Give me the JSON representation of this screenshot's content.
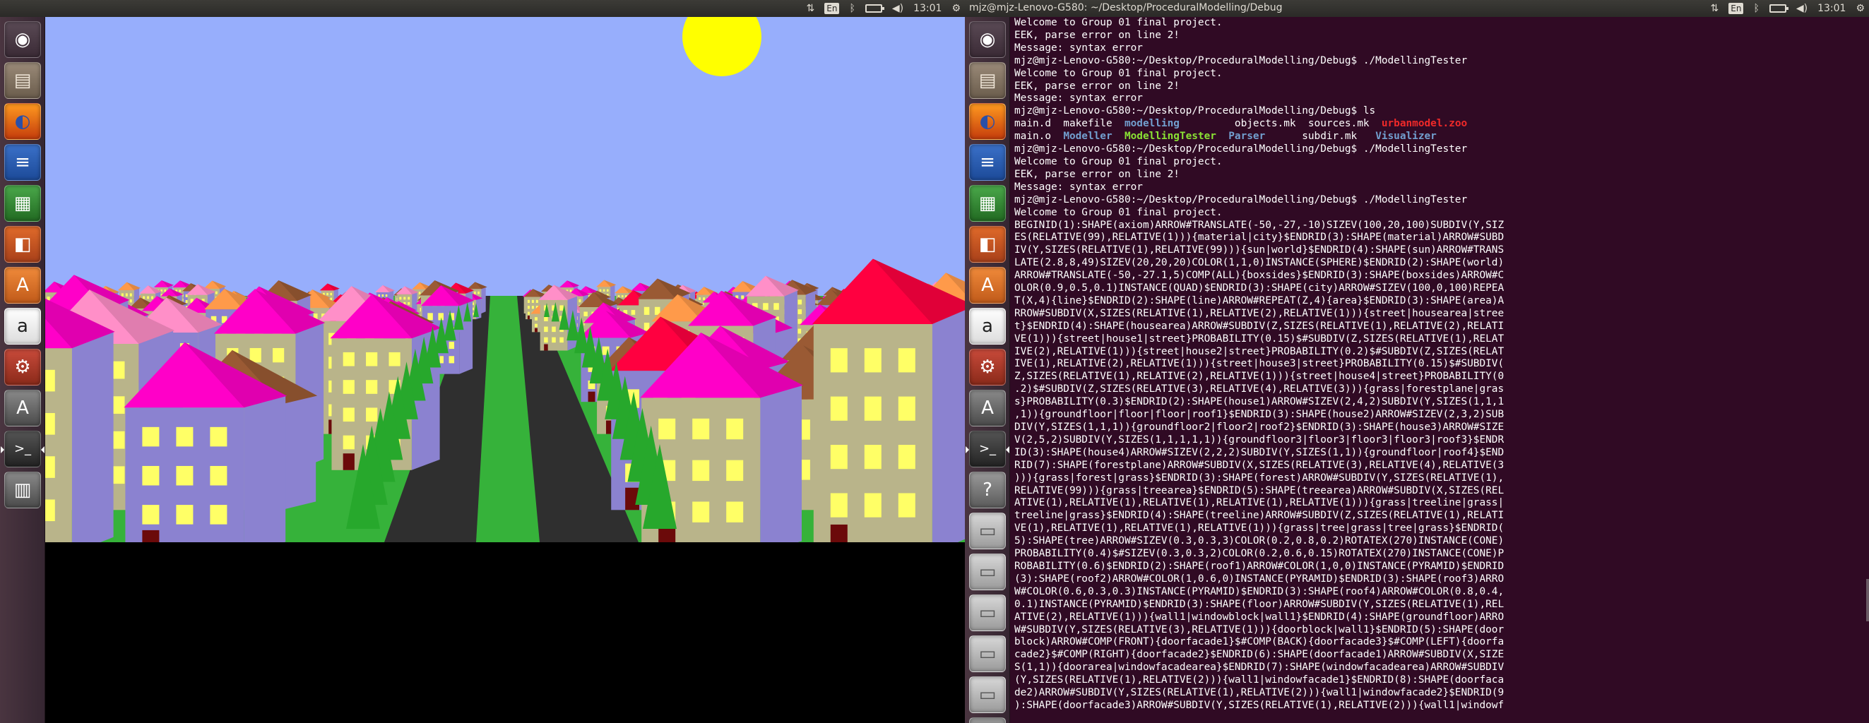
{
  "left_screen": {
    "clock": "13:01",
    "keyboard_layout": "En"
  },
  "right_screen": {
    "window_title": "mjz@mjz-Lenovo-G580: ~/Desktop/ProceduralModelling/Debug",
    "clock": "13:01",
    "keyboard_layout": "En"
  },
  "launcher": {
    "left_items": [
      "dash",
      "files",
      "firefox",
      "writer",
      "calc",
      "impress",
      "software-center",
      "amazon",
      "system-settings",
      "software-updater",
      "terminal",
      "workspaces"
    ],
    "right_items": [
      "dash",
      "files",
      "firefox",
      "writer",
      "calc",
      "impress",
      "software-center",
      "amazon",
      "system-settings",
      "software-updater",
      "terminal",
      "help",
      "drive-1",
      "drive-2",
      "drive-3",
      "drive-4",
      "drive-5",
      "trash"
    ]
  },
  "colors": {
    "sky": "#97aefc",
    "sun": "#ffff00",
    "ground": "#36b23a",
    "road": "#2f2f2f",
    "terminal_bg": "#300a24",
    "launcher": "#3f2d38",
    "roof_magenta": "#ff00c8",
    "roof_brown": "#9a5a34",
    "roof_pink": "#ff8fc8",
    "roof_orange": "#ff9a4a",
    "roof_red": "#ff0040",
    "wall_tan": "#b9b48a",
    "wall_purple": "#8b82d0",
    "window": "#ffff66",
    "door": "#6b0a0a"
  },
  "terminal": {
    "lines": [
      {
        "text": "Welcome to Group 01 final project."
      },
      {
        "text": "EEK, parse error on line 2!"
      },
      {
        "text": "Message: syntax error"
      },
      {
        "text": "mjz@mjz-Lenovo-G580:~/Desktop/ProceduralModelling/Debug$ ./ModellingTester"
      },
      {
        "text": "Welcome to Group 01 final project."
      },
      {
        "text": "EEK, parse error on line 2!"
      },
      {
        "text": "Message: syntax error"
      },
      {
        "text": "mjz@mjz-Lenovo-G580:~/Desktop/ProceduralModelling/Debug$ ls"
      },
      {
        "segments": [
          {
            "t": "main.d  makefile  ",
            "c": ""
          },
          {
            "t": "modelling",
            "c": "c-blue"
          },
          {
            "t": "         objects.mk  sources.mk  ",
            "c": ""
          },
          {
            "t": "urbanmodel.zoo",
            "c": "c-red"
          }
        ]
      },
      {
        "segments": [
          {
            "t": "main.o  ",
            "c": ""
          },
          {
            "t": "Modeller",
            "c": "c-blue"
          },
          {
            "t": "  ",
            "c": ""
          },
          {
            "t": "ModellingTester",
            "c": "c-green"
          },
          {
            "t": "  ",
            "c": ""
          },
          {
            "t": "Parser",
            "c": "c-blue"
          },
          {
            "t": "      subdir.mk   ",
            "c": ""
          },
          {
            "t": "Visualizer",
            "c": "c-blue"
          }
        ]
      },
      {
        "text": "mjz@mjz-Lenovo-G580:~/Desktop/ProceduralModelling/Debug$ ./ModellingTester"
      },
      {
        "text": "Welcome to Group 01 final project."
      },
      {
        "text": "EEK, parse error on line 2!"
      },
      {
        "text": "Message: syntax error"
      },
      {
        "text": "mjz@mjz-Lenovo-G580:~/Desktop/ProceduralModelling/Debug$ ./ModellingTester"
      },
      {
        "text": "Welcome to Group 01 final project."
      },
      {
        "text": "BEGINID(1):SHAPE(axiom)ARROW#TRANSLATE(-50,-27,-10)SIZEV(100,20,100)SUBDIV(Y,SIZ"
      },
      {
        "text": "ES(RELATIVE(99),RELATIVE(1))){material|city}$ENDRID(3):SHAPE(material)ARROW#SUBD"
      },
      {
        "text": "IV(Y,SIZES(RELATIVE(1),RELATIVE(99))){sun|world}$ENDRID(4):SHAPE(sun)ARROW#TRANS"
      },
      {
        "text": "LATE(2.8,8,49)SIZEV(20,20,20)COLOR(1,1,0)INSTANCE(SPHERE)$ENDRID(2):SHAPE(world)"
      },
      {
        "text": "ARROW#TRANSLATE(-50,-27.1,5)COMP(ALL){boxsides}$ENDRID(3):SHAPE(boxsides)ARROW#C"
      },
      {
        "text": "OLOR(0.9,0.5,0.1)INSTANCE(QUAD)$ENDRID(3):SHAPE(city)ARROW#SIZEV(100,0,100)REPEA"
      },
      {
        "text": "T(X,4){line}$ENDRID(2):SHAPE(line)ARROW#REPEAT(Z,4){area}$ENDRID(3):SHAPE(area)A"
      },
      {
        "text": "RROW#SUBDIV(X,SIZES(RELATIVE(1),RELATIVE(2),RELATIVE(1))){street|housearea|stree"
      },
      {
        "text": "t}$ENDRID(4):SHAPE(housearea)ARROW#SUBDIV(Z,SIZES(RELATIVE(1),RELATIVE(2),RELATI"
      },
      {
        "text": "VE(1))){street|house1|street}PROBABILITY(0.15)$#SUBDIV(Z,SIZES(RELATIVE(1),RELAT"
      },
      {
        "text": "IVE(2),RELATIVE(1))){street|house2|street}PROBABILITY(0.2)$#SUBDIV(Z,SIZES(RELAT"
      },
      {
        "text": "IVE(1),RELATIVE(2),RELATIVE(1))){street|house3|street}PROBABILITY(0.15)$#SUBDIV("
      },
      {
        "text": "Z,SIZES(RELATIVE(1),RELATIVE(2),RELATIVE(1))){street|house4|street}PROBABILITY(0"
      },
      {
        "text": ".2)$#SUBDIV(Z,SIZES(RELATIVE(3),RELATIVE(4),RELATIVE(3))){grass|forestplane|gras"
      },
      {
        "text": "s}PROBABILITY(0.3)$ENDRID(2):SHAPE(house1)ARROW#SIZEV(2,4,2)SUBDIV(Y,SIZES(1,1,1"
      },
      {
        "text": ",1)){groundfloor|floor|floor|roof1}$ENDRID(3):SHAPE(house2)ARROW#SIZEV(2,3,2)SUB"
      },
      {
        "text": "DIV(Y,SIZES(1,1,1)){groundfloor2|floor2|roof2}$ENDRID(3):SHAPE(house3)ARROW#SIZE"
      },
      {
        "text": "V(2,5,2)SUBDIV(Y,SIZES(1,1,1,1,1)){groundfloor3|floor3|floor3|floor3|roof3}$ENDR"
      },
      {
        "text": "ID(3):SHAPE(house4)ARROW#SIZEV(2,2,2)SUBDIV(Y,SIZES(1,1)){groundfloor|roof4}$END"
      },
      {
        "text": "RID(7):SHAPE(forestplane)ARROW#SUBDIV(X,SIZES(RELATIVE(3),RELATIVE(4),RELATIVE(3"
      },
      {
        "text": "))){grass|forest|grass}$ENDRID(3):SHAPE(forest)ARROW#SUBDIV(Y,SIZES(RELATIVE(1),"
      },
      {
        "text": "RELATIVE(99))){grass|treearea}$ENDRID(5):SHAPE(treearea)ARROW#SUBDIV(X,SIZES(REL"
      },
      {
        "text": "ATIVE(1),RELATIVE(1),RELATIVE(1),RELATIVE(1),RELATIVE(1))){grass|treeline|grass|"
      },
      {
        "text": "treeline|grass}$ENDRID(4):SHAPE(treeline)ARROW#SUBDIV(Z,SIZES(RELATIVE(1),RELATI"
      },
      {
        "text": "VE(1),RELATIVE(1),RELATIVE(1),RELATIVE(1))){grass|tree|grass|tree|grass}$ENDRID("
      },
      {
        "text": "5):SHAPE(tree)ARROW#SIZEV(0.3,0.3,3)COLOR(0.2,0.8,0.2)ROTATEX(270)INSTANCE(CONE)"
      },
      {
        "text": "PROBABILITY(0.4)$#SIZEV(0.3,0.3,2)COLOR(0.2,0.6,0.15)ROTATEX(270)INSTANCE(CONE)P"
      },
      {
        "text": "ROBABILITY(0.6)$ENDRID(2):SHAPE(roof1)ARROW#COLOR(1,0,0)INSTANCE(PYRAMID)$ENDRID"
      },
      {
        "text": "(3):SHAPE(roof2)ARROW#COLOR(1,0.6,0)INSTANCE(PYRAMID)$ENDRID(3):SHAPE(roof3)ARRO"
      },
      {
        "text": "W#COLOR(0.6,0.3,0.3)INSTANCE(PYRAMID)$ENDRID(3):SHAPE(roof4)ARROW#COLOR(0.8,0.4,"
      },
      {
        "text": "0.1)INSTANCE(PYRAMID)$ENDRID(3):SHAPE(floor)ARROW#SUBDIV(Y,SIZES(RELATIVE(1),REL"
      },
      {
        "text": "ATIVE(2),RELATIVE(1))){wall1|windowblock|wall1}$ENDRID(4):SHAPE(groundfloor)ARRO"
      },
      {
        "text": "W#SUBDIV(Y,SIZES(RELATIVE(3),RELATIVE(1))){doorblock|wall1}$ENDRID(5):SHAPE(door"
      },
      {
        "text": "block)ARROW#COMP(FRONT){doorfacade1}$#COMP(BACK){doorfacade3}$#COMP(LEFT){doorfa"
      },
      {
        "text": "cade2}$#COMP(RIGHT){doorfacade2}$ENDRID(6):SHAPE(doorfacade1)ARROW#SUBDIV(X,SIZE"
      },
      {
        "text": "S(1,1)){doorarea|windowfacadearea}$ENDRID(7):SHAPE(windowfacadearea)ARROW#SUBDIV"
      },
      {
        "text": "(Y,SIZES(RELATIVE(1),RELATIVE(2))){wall1|windowfacade1}$ENDRID(8):SHAPE(doorfaca"
      },
      {
        "text": "de2)ARROW#SUBDIV(Y,SIZES(RELATIVE(1),RELATIVE(2))){wall1|windowfacade2}$ENDRID(9"
      },
      {
        "text": "):SHAPE(doorfacade3)ARROW#SUBDIV(Y,SIZES(RELATIVE(1),RELATIVE(2))){wall1|windowf"
      }
    ]
  }
}
